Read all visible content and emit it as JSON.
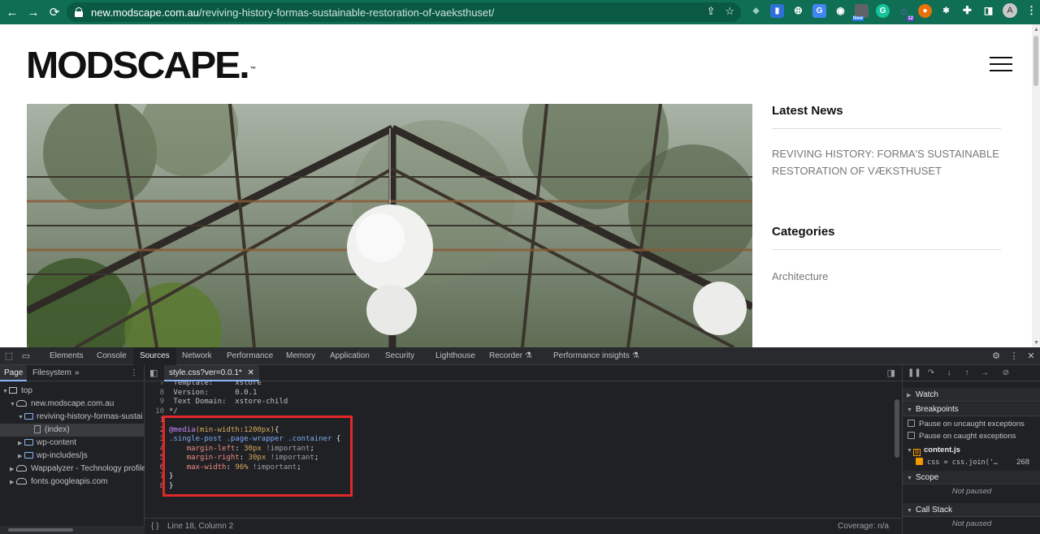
{
  "browser": {
    "url_host": "new.modscape.com.au",
    "url_path": "/reviving-history-formas-sustainable-restoration-of-vaeksthuset/",
    "avatar_initial": "A",
    "ext_new_badge": "New",
    "ext_count_badge": "12"
  },
  "site": {
    "logo": "MODSCAPE.",
    "logo_tm": "™",
    "latest_news_title": "Latest News",
    "latest_news_item": "REVIVING HISTORY: FORMA'S SUSTAINABLE RESTORATION OF VÆKSTHUSET",
    "categories_title": "Categories",
    "categories_item": "Architecture"
  },
  "devtools": {
    "tabs": [
      "Elements",
      "Console",
      "Sources",
      "Network",
      "Performance",
      "Memory",
      "Application",
      "Security",
      "Lighthouse",
      "Recorder",
      "Performance insights"
    ],
    "active_tab": "Sources",
    "navigator": {
      "tab_page": "Page",
      "tab_filesystem": "Filesystem",
      "more": "»",
      "tree": [
        {
          "label": "top"
        },
        {
          "label": "new.modscape.com.au"
        },
        {
          "label": "reviving-history-formas-sustai"
        },
        {
          "label": "(index)"
        },
        {
          "label": "wp-content"
        },
        {
          "label": "wp-includes/js"
        },
        {
          "label": "Wappalyzer - Technology profiler"
        },
        {
          "label": "fonts.googleapis.com"
        }
      ]
    },
    "editor": {
      "file_tab": "style.css?ver=0.0.1*",
      "top_lines": [
        {
          "n": "8",
          "text": " Version:      0.0.1"
        },
        {
          "n": "9",
          "text": " Text Domain:  xstore-child"
        },
        {
          "n": "10",
          "text": "*/"
        }
      ],
      "code": {
        "l2_at": "@media",
        "l2_cond": "(min-width:1200px)",
        "l2_brace": "{",
        "l3_sel": ".single-post .page-wrapper .container",
        "l3_brace": " {",
        "l4_prop": "margin-left",
        "l4_val": "30px",
        "l5_prop": "margin-right",
        "l5_val": "30px",
        "l6_prop": "max-width",
        "l6_val": "96%",
        "important": "!important",
        "close": "}"
      },
      "line_numbers": [
        "1",
        "2",
        "3",
        "4",
        "5",
        "6",
        "7",
        "8"
      ],
      "status_position": "Line 18, Column 2",
      "status_coverage": "Coverage: n/a"
    },
    "debugger": {
      "watch": "Watch",
      "breakpoints": "Breakpoints",
      "pause_uncaught": "Pause on uncaught exceptions",
      "pause_caught": "Pause on caught exceptions",
      "bp_file": "content.js",
      "bp_code": "css = css.join('…",
      "bp_line": "268",
      "scope": "Scope",
      "not_paused_1": "Not paused",
      "call_stack": "Call Stack",
      "not_paused_2": "Not paused"
    }
  }
}
